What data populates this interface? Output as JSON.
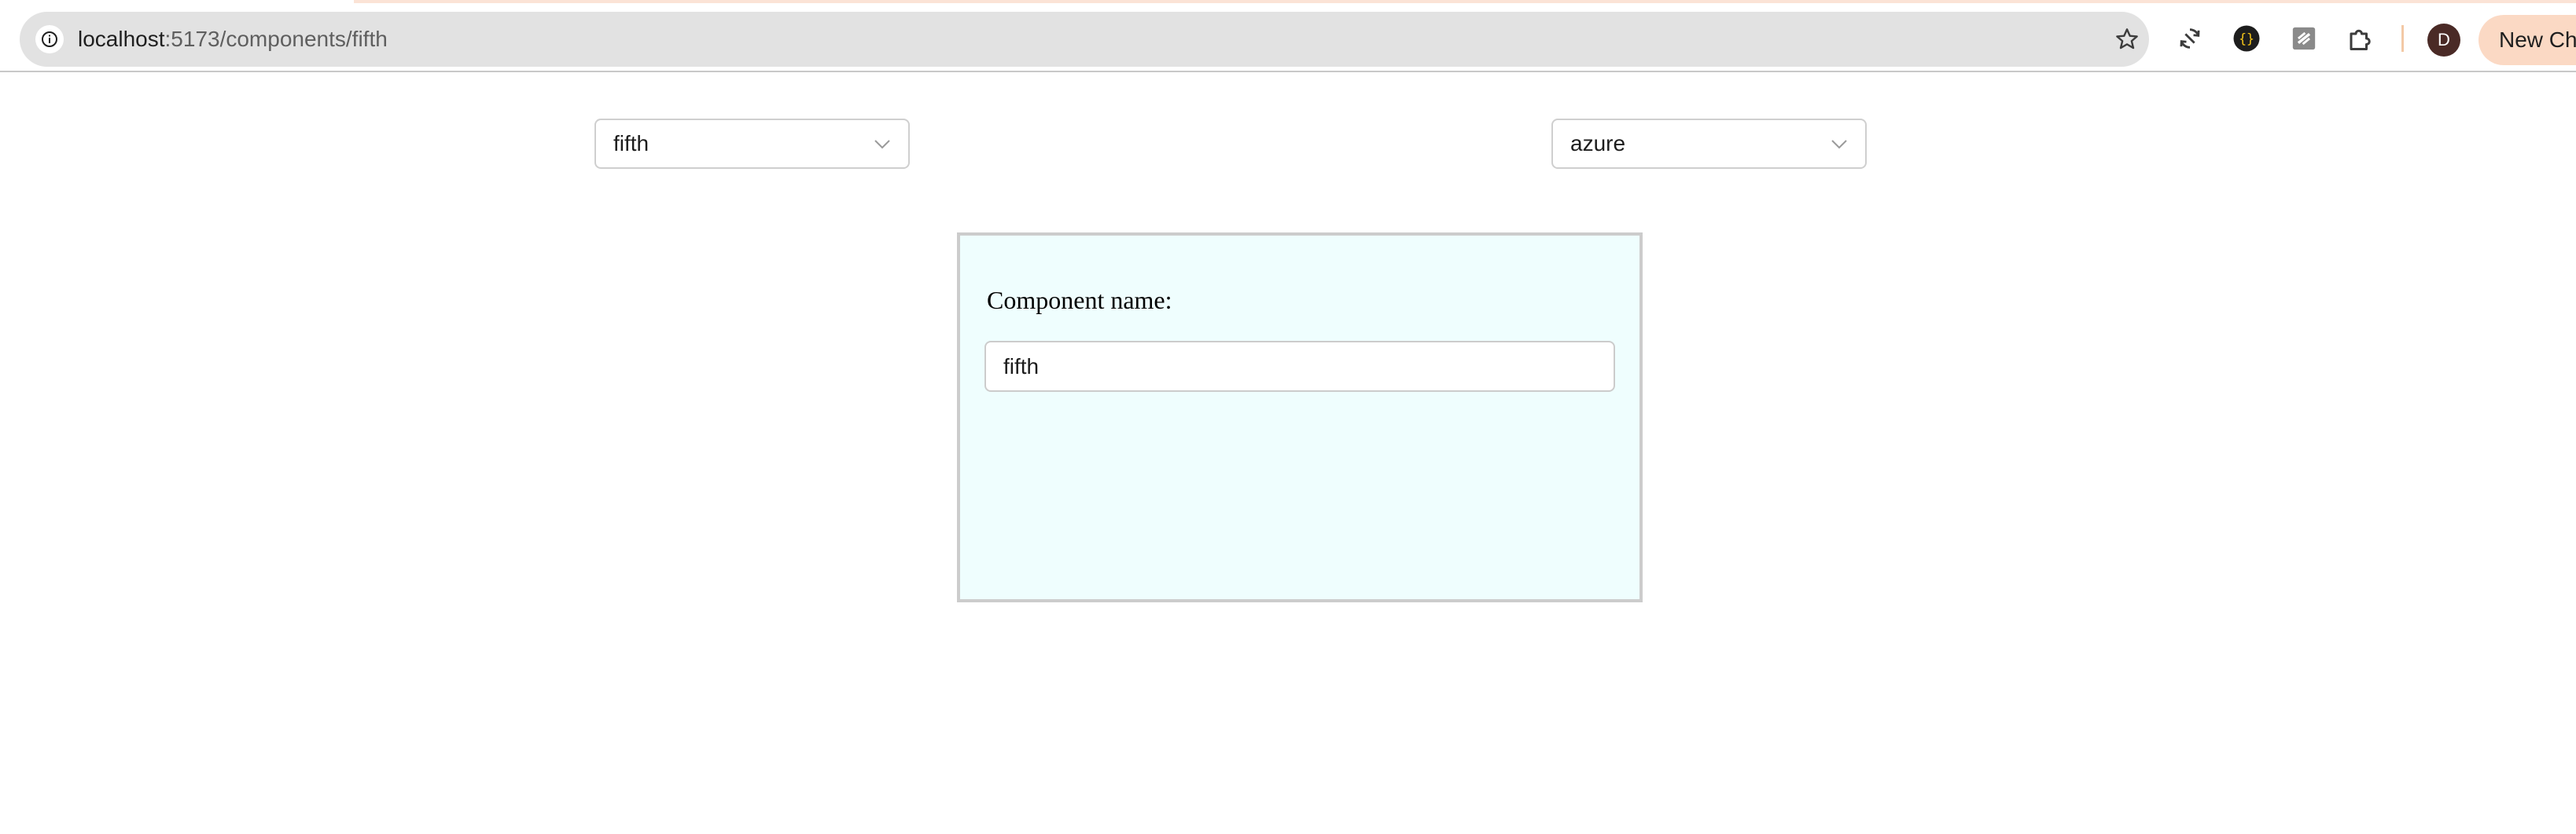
{
  "browser": {
    "url_host": "localhost",
    "url_path": ":5173/components/fifth",
    "avatar_letter": "D",
    "new_chrome_label": "New Ch",
    "icons": [
      "info-icon",
      "star-icon",
      "sync-icon",
      "json-extension-icon",
      "extension-icon",
      "puzzle-icon"
    ]
  },
  "controls": {
    "component_select": {
      "value": "fifth"
    },
    "color_select": {
      "value": "azure"
    }
  },
  "panel": {
    "label": "Component name:",
    "input_value": "fifth",
    "background": "#effefe"
  }
}
